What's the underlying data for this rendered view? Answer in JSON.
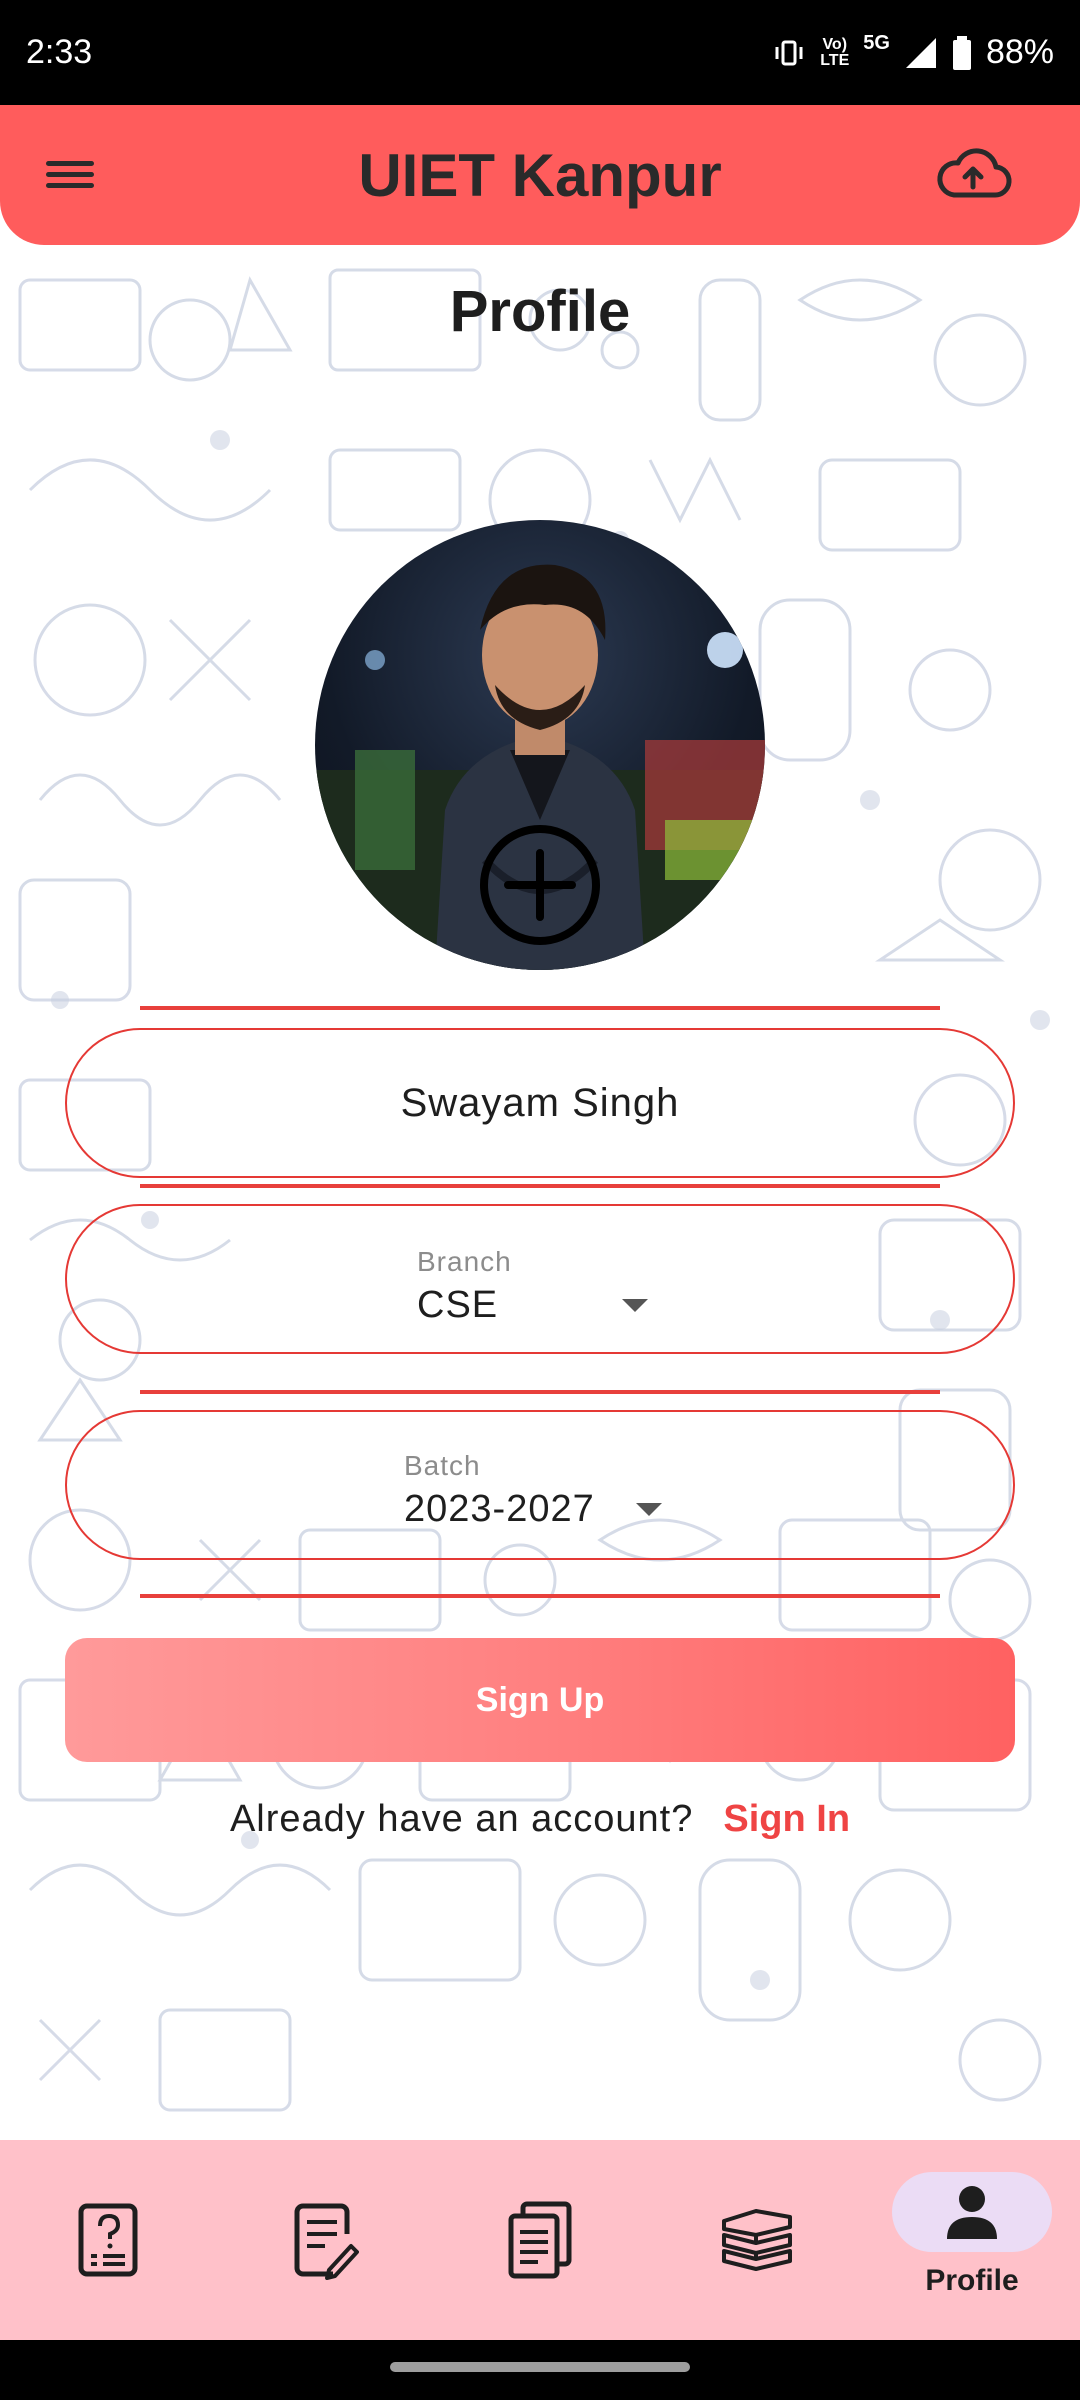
{
  "status_bar": {
    "time": "2:33",
    "network_top": "Vo)",
    "network_bottom": "LTE",
    "signal_label": "5G",
    "battery": "88%"
  },
  "app_bar": {
    "title": "UIET Kanpur",
    "menu_icon": "menu-icon",
    "upload_icon": "cloud-upload-icon"
  },
  "page": {
    "title": "Profile"
  },
  "form": {
    "name_value": "Swayam Singh",
    "branch_label": "Branch",
    "branch_value": "CSE",
    "batch_label": "Batch",
    "batch_value": "2023-2027",
    "signup_label": "Sign Up",
    "signin_prompt": "Already have an account?",
    "signin_link": "Sign In"
  },
  "bottom_nav": {
    "items": [
      {
        "icon": "question-paper-icon",
        "label": ""
      },
      {
        "icon": "notes-edit-icon",
        "label": ""
      },
      {
        "icon": "documents-icon",
        "label": ""
      },
      {
        "icon": "books-icon",
        "label": ""
      },
      {
        "icon": "profile-icon",
        "label": "Profile"
      }
    ],
    "active_index": 4
  },
  "colors": {
    "accent": "#ff5c5c",
    "border": "#e53935",
    "link": "#ef4444",
    "nav_bg": "#ffc1c9",
    "active_pill": "#ebdcf5"
  }
}
